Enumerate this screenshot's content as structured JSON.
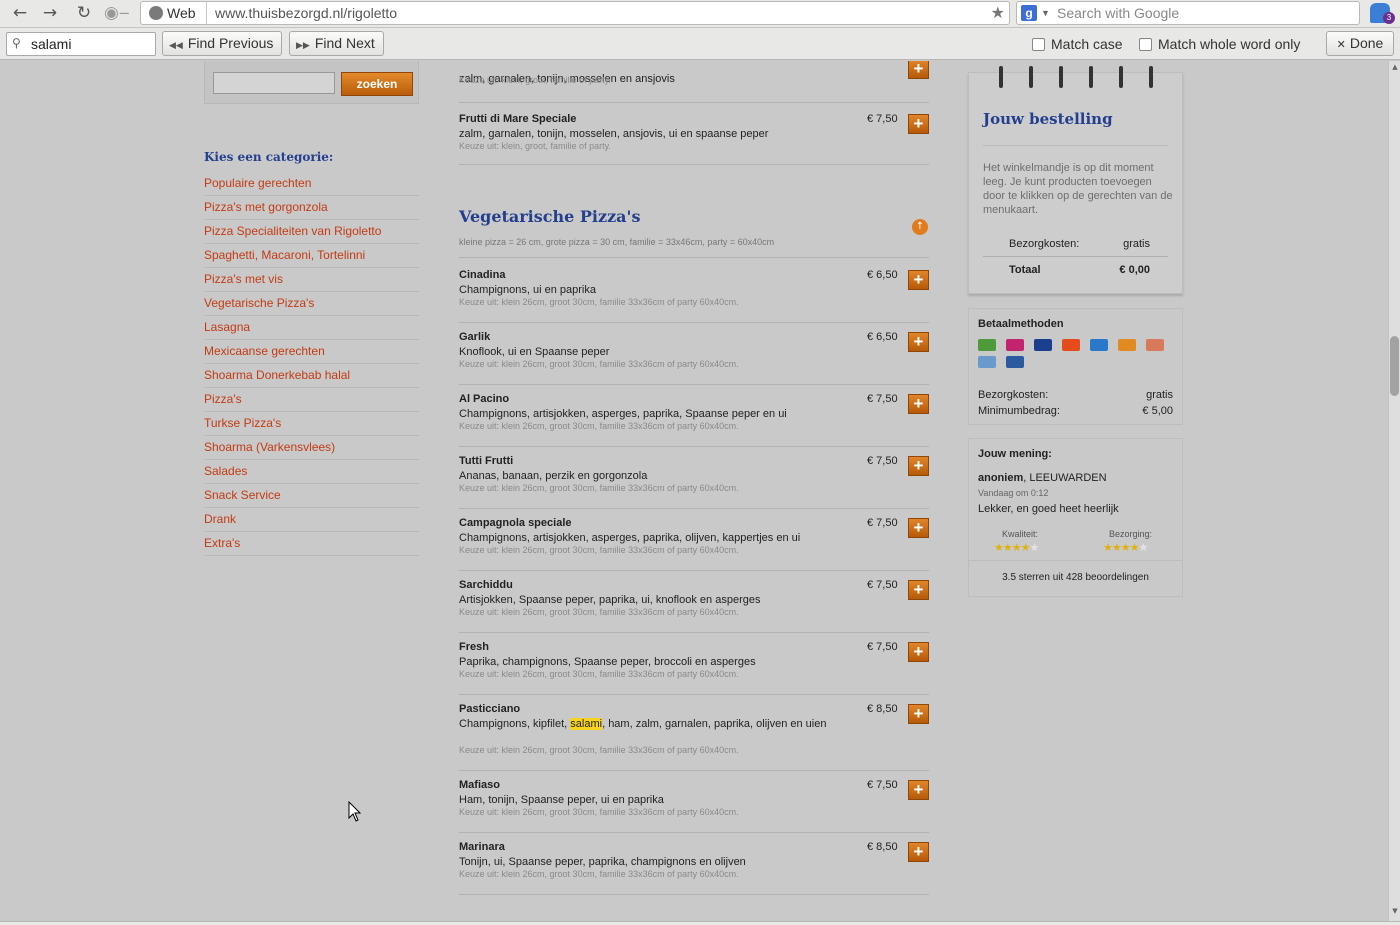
{
  "browser": {
    "url_label": "Web",
    "url": "www.thuisbezorgd.nl/rigoletto",
    "search_placeholder": "Search with Google",
    "search_engine_glyph": "g",
    "extension_badge": "3",
    "nav_icons": [
      "back-arrow-icon",
      "forward-arrow-icon",
      "reload-icon",
      "key-icon"
    ]
  },
  "findbar": {
    "query": "salami",
    "find_previous": "Find Previous",
    "find_next": "Find Next",
    "match_case": "Match case",
    "match_whole_word": "Match whole word only",
    "done": "Done"
  },
  "sidebar": {
    "search_button": "zoeken",
    "title": "Kies een categorie:",
    "categories": [
      "Populaire gerechten",
      "Pizza's met gorgonzola",
      "Pizza Specialiteiten van Rigoletto",
      "Spaghetti, Macaroni, Tortelinni",
      "Pizza's met vis",
      "Vegetarische Pizza's",
      "Lasagna",
      "Mexicaanse gerechten",
      "Shoarma Donerkebab halal",
      "Pizza's",
      "Turkse Pizza's",
      "Shoarma (Varkensvlees)",
      "Salades",
      "Snack Service",
      "Drank",
      "Extra's"
    ]
  },
  "menu": {
    "top_items": [
      {
        "name": "",
        "desc": "zalm, garnalen, tonijn, mosselen en ansjovis",
        "note": "Keuze uit: klein, groot, familie of party.",
        "price": ""
      },
      {
        "name": "Frutti di Mare Speciale",
        "desc": "zalm, garnalen, tonijn, mosselen, ansjovis, ui en spaanse peper",
        "note": "Keuze uit: klein, groot, familie of party.",
        "price": "€ 7,50"
      }
    ],
    "category_title": "Vegetarische Pizza's",
    "category_subtitle": "kleine pizza = 26 cm, grote pizza = 30 cm, familie = 33x46cm, party = 60x40cm",
    "note": "Keuze uit: klein 26cm, groot 30cm, familie 33x36cm of party 60x40cm.",
    "items": [
      {
        "name": "Cinadina",
        "desc": "Champignons, ui en paprika",
        "price": "€ 6,50"
      },
      {
        "name": "Garlik",
        "desc": "Knoflook, ui en Spaanse peper",
        "price": "€ 6,50"
      },
      {
        "name": "Al Pacino",
        "desc": "Champignons, artisjokken, asperges, paprika, Spaanse peper en ui",
        "price": "€ 7,50"
      },
      {
        "name": "Tutti Frutti",
        "desc": "Ananas, banaan, perzik en gorgonzola",
        "price": "€ 7,50"
      },
      {
        "name": "Campagnola speciale",
        "desc": "Champignons, artisjokken, asperges, paprika, olijven, kappertjes en ui",
        "price": "€ 7,50"
      },
      {
        "name": "Sarchiddu",
        "desc": "Artisjokken, Spaanse peper, paprika, ui, knoflook en asperges",
        "price": "€ 7,50"
      },
      {
        "name": "Fresh",
        "desc": "Paprika, champignons, Spaanse peper, broccoli en asperges",
        "price": "€ 7,50"
      },
      {
        "name": "Pasticciano",
        "desc_before": "Champignons, kipfilet, ",
        "desc_highlight": "salami",
        "desc_after": ", ham, zalm, garnalen, paprika, olijven en uien",
        "price": "€ 8,50"
      },
      {
        "name": "Mafiaso",
        "desc": "Ham, tonijn, Spaanse peper, ui en paprika",
        "price": "€ 7,50"
      },
      {
        "name": "Marinara",
        "desc": "Tonijn, ui, Spaanse peper, paprika, champignons en olijven",
        "price": "€ 8,50"
      }
    ],
    "add_glyph": "+"
  },
  "order": {
    "title": "Jouw bestelling",
    "empty_text": "Het winkelmandje is op dit moment leeg. Je kunt producten toevoegen door te klikken op de gerechten van de menukaart.",
    "delivery_label": "Bezorgkosten:",
    "delivery_value": "gratis",
    "total_label": "Totaal",
    "total_value": "€ 0,00"
  },
  "payment": {
    "title": "Betaalmethoden",
    "icons": [
      "cash-icon",
      "ideal-icon",
      "visa-icon",
      "mastercard-icon",
      "amex-icon",
      "pin-icon",
      "creditcard-icon",
      "bank-icon",
      "paypal-icon"
    ],
    "delivery_label": "Bezorgkosten:",
    "delivery_value": "gratis",
    "minimum_label": "Minimumbedrag:",
    "minimum_value": "€ 5,00"
  },
  "review": {
    "title": "Jouw mening:",
    "author_name": "anoniem",
    "author_city": ", LEEUWARDEN",
    "date": "Vandaag om 0:12",
    "text": "Lekker, en goed heet heerlijk",
    "quality_label": "Kwaliteit:",
    "delivery_label": "Bezorging:",
    "quality_stars": 4,
    "delivery_stars": 4,
    "max_stars": 5,
    "summary": "3.5 sterren uit 428 beoordelingen"
  },
  "colors": {
    "accent_orange": "#d8701a",
    "link_red": "#c33b14",
    "heading_blue": "#233f8e",
    "highlight_yellow": "#f6d421"
  }
}
